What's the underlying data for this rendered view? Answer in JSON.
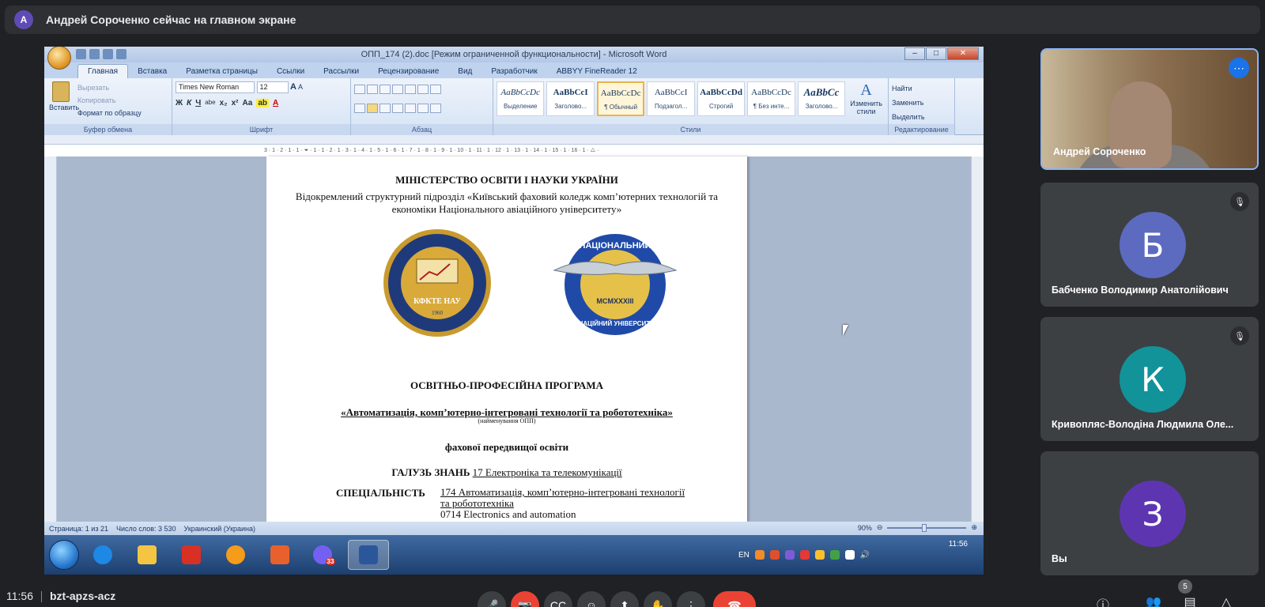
{
  "presenter_bar": {
    "avatar_letter": "A",
    "text": "Андрей Сороченко сейчас на главном экране"
  },
  "word": {
    "title": "ОПП_174 (2).doc [Режим ограниченной функциональности] - Microsoft Word",
    "tabs": [
      "Главная",
      "Вставка",
      "Разметка страницы",
      "Ссылки",
      "Рассылки",
      "Рецензирование",
      "Вид",
      "Разработчик",
      "ABBYY FineReader 12"
    ],
    "clipboard": {
      "paste": "Вставить",
      "cut": "Вырезать",
      "copy": "Копировать",
      "format_painter": "Формат по образцу",
      "label": "Буфер обмена"
    },
    "font": {
      "name": "Times New Roman",
      "size": "12",
      "label": "Шрифт",
      "buttons": [
        "Ж",
        "К",
        "Ч",
        "abe",
        "x₂",
        "x²",
        "Aa"
      ]
    },
    "paragraph": {
      "label": "Абзац"
    },
    "styles": {
      "label": "Стили",
      "items": [
        {
          "preview": "AaBbCcDc",
          "name": "Выделение",
          "bold": false,
          "italic": true
        },
        {
          "preview": "AaBbCcI",
          "name": "Заголово...",
          "bold": true,
          "italic": false
        },
        {
          "preview": "AaBbCcDc",
          "name": "¶ Обычный",
          "bold": false,
          "italic": false,
          "selected": true
        },
        {
          "preview": "AaBbCcI",
          "name": "Подзагол...",
          "bold": false,
          "italic": false
        },
        {
          "preview": "AaBbCcDd",
          "name": "Строгий",
          "bold": true,
          "italic": false
        },
        {
          "preview": "AaBbCcDc",
          "name": "¶ Без инте...",
          "bold": false,
          "italic": false
        },
        {
          "preview": "AaBbCc",
          "name": "Заголово...",
          "bold": true,
          "italic": true
        }
      ],
      "change_styles": "Изменить стили"
    },
    "editing": {
      "label": "Редактирование",
      "find": "Найти",
      "replace": "Заменить",
      "select": "Выделить"
    },
    "ruler_text": "3 · 1 · 2 · 1 · 1 · ⏷ · 1 · 1 · 2 · 1 · 3 · 1 · 4 · 1 · 5 · 1 · 6 · 1 · 7 · 1 · 8 · 1 · 9 · 1 · 10 · 1 · 11 · 1 · 12 · 1 · 13 · 1 · 14 · 1 · 15 · 1 · 16 · 1 · △ ·",
    "document": {
      "line1": "МІНІСТЕРСТВО ОСВІТИ І НАУКИ УКРАЇНИ",
      "line2": "Відокремлений структурний підрозділ «Київський фаховий коледж комп’ютерних технологій та економіки Національного авіаційного університету»",
      "logo1_text": "КФКТЕ НАУ",
      "logo1_year": "1960",
      "logo2_top": "НАЦІОНАЛЬНИЙ",
      "logo2_mid": "MCMXXXIII",
      "logo2_bottom": "АВІАЦІЙНИЙ УНІВЕРСИТЕТ",
      "heading1": "ОСВІТНЬО-ПРОФЕСІЙНА ПРОГРАМА",
      "heading2": "«Автоматизація, комп’ютерно-інтегровані технології та робототехніка»",
      "heading2_sub": "(найменування ОПП)",
      "heading3": "фахової передвищої освіти",
      "field_label": "ГАЛУЗЬ ЗНАНЬ",
      "field_value": "17 Електроніка та телекомунікації",
      "spec_label": "СПЕЦІАЛЬНІСТЬ",
      "spec_value1": "174 Автоматизація, комп’ютерно-інтегровані технології",
      "spec_value2": "та робототехніка",
      "spec_value3": "0714 Electronics and automation"
    },
    "status": {
      "page": "Страница: 1 из 21",
      "words": "Число слов: 3 530",
      "lang": "Украинский (Украина)",
      "zoom": "90%"
    },
    "taskbar": {
      "lang": "EN",
      "clock": "11:56",
      "viber_badge": "33"
    }
  },
  "participants": [
    {
      "name": "Андрей Сороченко",
      "type": "video"
    },
    {
      "name": "Бабченко Володимир Анатолійович",
      "letter": "Б",
      "color": "#5c6bc0",
      "muted": true
    },
    {
      "name": "Кривопляс-Володіна Людмила Оле...",
      "letter": "К",
      "color": "#12939a",
      "muted": true
    },
    {
      "name": "Вы",
      "letter": "З",
      "color": "#5e35b1",
      "muted": false
    }
  ],
  "bottom": {
    "time": "11:56",
    "meeting_code": "bzt-apzs-acz",
    "people_count": "5"
  },
  "colors": {
    "background": "#202124",
    "accent": "#8ab4f8",
    "end_call": "#ea4335"
  }
}
